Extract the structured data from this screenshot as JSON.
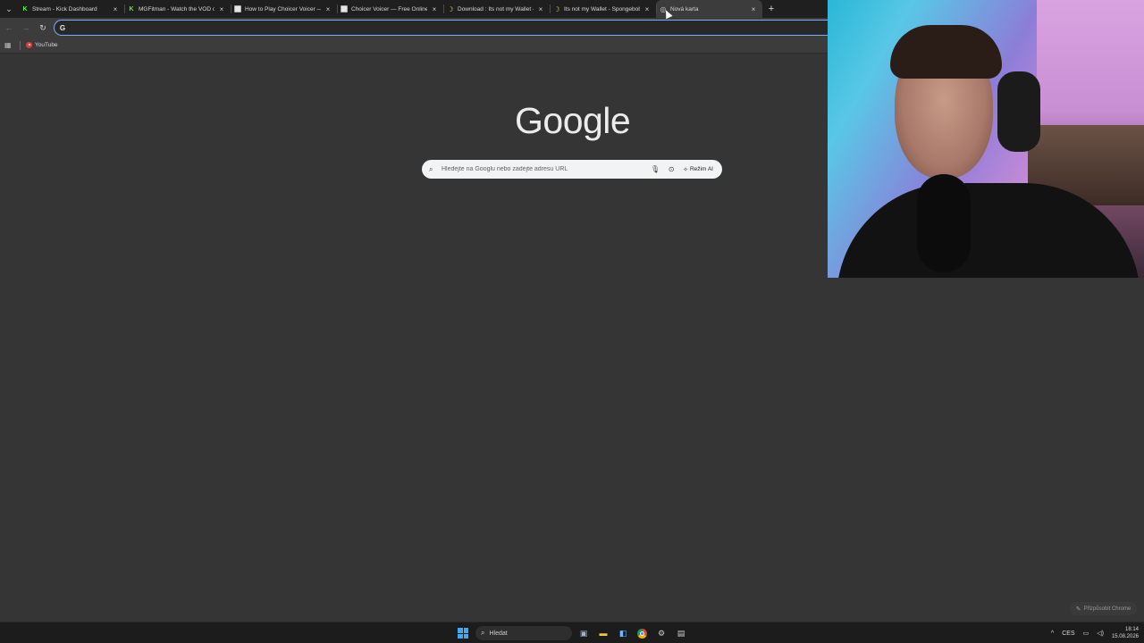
{
  "browser": {
    "tabs": [
      {
        "favicon": "kick-icon",
        "title": "Stream - Kick Dashboard",
        "active": false
      },
      {
        "favicon": "kick-icon",
        "title": "MGFitman - Watch the VOD on",
        "active": false
      },
      {
        "favicon": "page-icon",
        "title": "How to Play Choicer Voicer — I",
        "active": false
      },
      {
        "favicon": "page-icon",
        "title": "Choicer Voicer — Free Online V",
        "active": false
      },
      {
        "favicon": "banana-icon",
        "title": "Download : Its not my Wallet -",
        "active": false
      },
      {
        "favicon": "banana-icon",
        "title": "Its not my Wallet - Spongebob",
        "active": false
      },
      {
        "favicon": "chrome-icon",
        "title": "Nová karta",
        "active": true
      }
    ],
    "tab_close_glyph": "×",
    "new_tab_glyph": "+",
    "omnibox": {
      "value": "",
      "placeholder": "",
      "badge": "G"
    },
    "bookmarks": [
      {
        "label": "YouTube",
        "icon": "youtube-icon"
      }
    ]
  },
  "ntp": {
    "logo_text": "Google",
    "search_placeholder": "Hledejte na Googlu nebo zadejte adresu URL",
    "ai_mode_label": "Režim AI",
    "customize_label": "Přizpůsobit Chrome"
  },
  "taskbar": {
    "search_label": "Hledat",
    "language": "CES",
    "time": "18:14",
    "date": "15.08.2026"
  },
  "colors": {
    "page_bg": "#353535",
    "tabstrip_bg": "#1f1f1f",
    "toolbar_bg": "#3c3c3c",
    "omnibox_focus": "#7cacf8",
    "kick_green": "#53fc18",
    "searchbox_bg": "#f1f3f4"
  }
}
